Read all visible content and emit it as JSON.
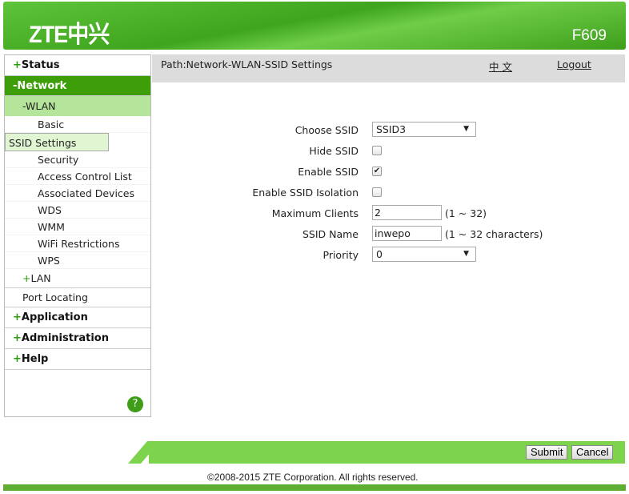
{
  "header": {
    "logo": "ZTE中兴",
    "model": "F609"
  },
  "sidebar": {
    "status": "Status",
    "network": "-Network",
    "wlan": "-WLAN",
    "wlan_items": [
      "Basic",
      "SSID Settings",
      "Security",
      "Access Control List",
      "Associated Devices",
      "WDS",
      "WMM",
      "WiFi Restrictions",
      "WPS"
    ],
    "lan": "LAN",
    "port_locating": "Port Locating",
    "application": "Application",
    "administration": "Administration",
    "help": "Help",
    "plus": "+",
    "help_icon": "?"
  },
  "pathbar": {
    "path": "Path:Network-WLAN-SSID Settings",
    "language": "中 文",
    "logout": "Logout"
  },
  "form": {
    "choose_ssid": {
      "label": "Choose SSID",
      "value": "SSID3"
    },
    "hide_ssid": {
      "label": "Hide SSID",
      "checked": false
    },
    "enable_ssid": {
      "label": "Enable SSID",
      "checked": true
    },
    "isolation": {
      "label": "Enable SSID Isolation",
      "checked": false
    },
    "max_clients": {
      "label": "Maximum Clients",
      "value": "2",
      "hint": "(1 ~ 32)"
    },
    "ssid_name": {
      "label": "SSID Name",
      "value": "inwepo",
      "hint": "(1 ~ 32 characters)"
    },
    "priority": {
      "label": "Priority",
      "value": "0"
    }
  },
  "footer": {
    "submit": "Submit",
    "cancel": "Cancel",
    "copyright": "©2008-2015 ZTE Corporation. All rights reserved."
  }
}
